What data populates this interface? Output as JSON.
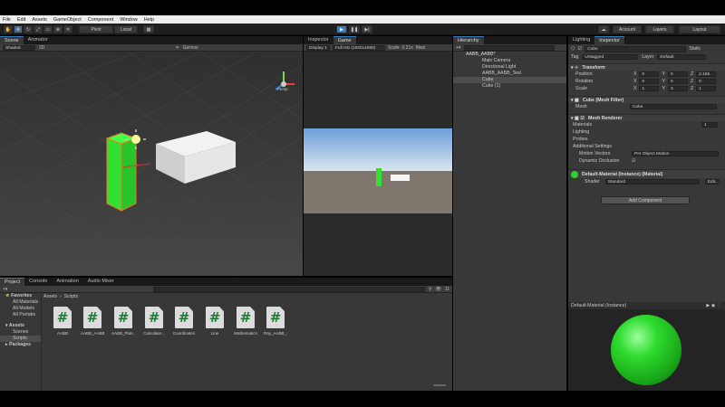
{
  "menu": [
    "File",
    "Edit",
    "Assets",
    "GameObject",
    "Component",
    "Window",
    "Help"
  ],
  "toolbar": {
    "pivot_label": "Pivot",
    "local_label": "Local",
    "account_label": "Account",
    "layers_label": "Layers",
    "layout_label": "Layout"
  },
  "scene": {
    "tabs": [
      "Scene",
      "Animator"
    ],
    "shading_label": "Shaded",
    "mode_2d": "2D",
    "gizmos_label": "Gizmos",
    "persp_label": "Persp"
  },
  "game": {
    "tabs": [
      "Inspector",
      "Game"
    ],
    "display_label": "Display 1",
    "resolution_label": "Full HD (1920x1080)",
    "scale_label": "Scale",
    "scale_value": "0.21x",
    "maximize_label": "Maxi"
  },
  "hierarchy": {
    "tab": "Hierarchy",
    "scene_name": "AABB_AABB*",
    "items": [
      "Main Camera",
      "Directional Light",
      "AABB_AABB_Test",
      "Cube",
      "Cube (1)"
    ]
  },
  "inspector": {
    "tabs": [
      "Lighting",
      "Inspector"
    ],
    "object_name": "Cube",
    "static_label": "Static",
    "tag_label": "Tag",
    "tag_value": "Untagged",
    "layer_label": "Layer",
    "layer_value": "Default",
    "transform": {
      "title": "Transform",
      "position_label": "Position",
      "rotation_label": "Rotation",
      "scale_label": "Scale",
      "position": [
        "0",
        "0",
        "2.165"
      ],
      "rotation": [
        "0",
        "0",
        "0"
      ],
      "scale": [
        "1",
        "3",
        "1"
      ]
    },
    "mesh_filter": {
      "title": "Cube (Mesh Filter)",
      "mesh_label": "Mesh",
      "mesh_value": "Cube"
    },
    "mesh_renderer": {
      "title": "Mesh Renderer",
      "materials_label": "Materials",
      "materials_count": "1",
      "lighting_label": "Lighting",
      "probes_label": "Probes",
      "additional_label": "Additional Settings",
      "motion_vectors_label": "Motion Vectors",
      "motion_vectors_value": "Per Object Motion",
      "dynamic_occlusion_label": "Dynamic Occlusion"
    },
    "material": {
      "title": "Default-Material (Instance) (Material)",
      "shader_label": "Shader",
      "shader_value": "Standard",
      "edit_label": "Edit..."
    },
    "add_component": "Add Component",
    "preview_title": "Default-Material (Instance)"
  },
  "project": {
    "tabs": [
      "Project",
      "Console",
      "Animation",
      "Audio Mixer"
    ],
    "favorites_label": "Favorites",
    "favorites": [
      "All Materials",
      "All Models",
      "All Prefabs"
    ],
    "assets_label": "Assets",
    "asset_folders": [
      "Scenes",
      "Scripts"
    ],
    "packages_label": "Packages",
    "breadcrumb": [
      "Assets",
      "Scripts"
    ],
    "scripts": [
      "AABB",
      "AABB_AABB...",
      "AABB_Plan...",
      "CalculateI...",
      "Coordinates",
      "Line",
      "Mathematics",
      "Ray_AABB_..."
    ],
    "hidden_count": "11"
  },
  "colors": {
    "accent": "#3a79bb",
    "cube_green": "#31e031",
    "selection_orange": "#f07828"
  }
}
